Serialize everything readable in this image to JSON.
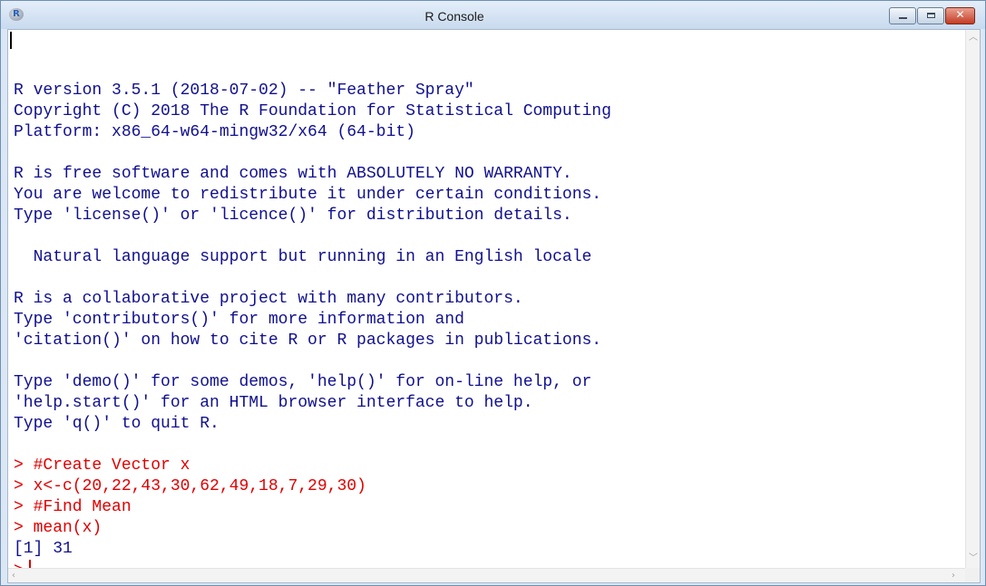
{
  "window": {
    "title": "R Console",
    "icon": "r-logo-icon",
    "icon_letter": "R",
    "close_glyph": "✕"
  },
  "console": {
    "lines": [
      {
        "text": "",
        "kind": "out"
      },
      {
        "text": "R version 3.5.1 (2018-07-02) -- \"Feather Spray\"",
        "kind": "out"
      },
      {
        "text": "Copyright (C) 2018 The R Foundation for Statistical Computing",
        "kind": "out"
      },
      {
        "text": "Platform: x86_64-w64-mingw32/x64 (64-bit)",
        "kind": "out"
      },
      {
        "text": "",
        "kind": "out"
      },
      {
        "text": "R is free software and comes with ABSOLUTELY NO WARRANTY.",
        "kind": "out"
      },
      {
        "text": "You are welcome to redistribute it under certain conditions.",
        "kind": "out"
      },
      {
        "text": "Type 'license()' or 'licence()' for distribution details.",
        "kind": "out"
      },
      {
        "text": "",
        "kind": "out"
      },
      {
        "text": "  Natural language support but running in an English locale",
        "kind": "out"
      },
      {
        "text": "",
        "kind": "out"
      },
      {
        "text": "R is a collaborative project with many contributors.",
        "kind": "out"
      },
      {
        "text": "Type 'contributors()' for more information and",
        "kind": "out"
      },
      {
        "text": "'citation()' on how to cite R or R packages in publications.",
        "kind": "out"
      },
      {
        "text": "",
        "kind": "out"
      },
      {
        "text": "Type 'demo()' for some demos, 'help()' for on-line help, or",
        "kind": "out"
      },
      {
        "text": "'help.start()' for an HTML browser interface to help.",
        "kind": "out"
      },
      {
        "text": "Type 'q()' to quit R.",
        "kind": "out"
      },
      {
        "text": "",
        "kind": "out"
      },
      {
        "text": "> #Create Vector x",
        "kind": "cmd"
      },
      {
        "text": "> x<-c(20,22,43,30,62,49,18,7,29,30)",
        "kind": "cmd"
      },
      {
        "text": "> #Find Mean",
        "kind": "cmd"
      },
      {
        "text": "> mean(x)",
        "kind": "cmd"
      },
      {
        "text": "[1] 31",
        "kind": "out"
      }
    ],
    "prompt": ">"
  },
  "colors": {
    "output": "#10108f",
    "command": "#e00000"
  }
}
